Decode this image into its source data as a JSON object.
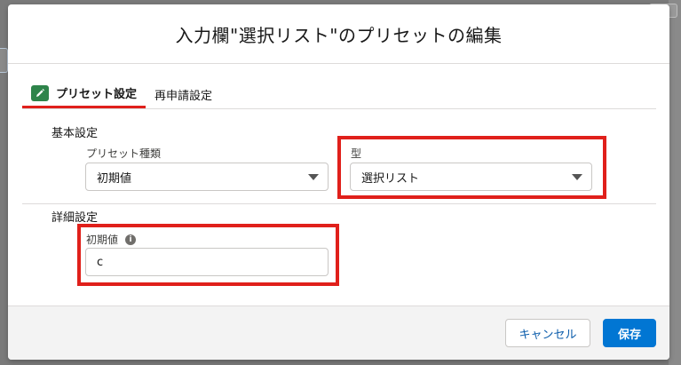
{
  "modal": {
    "title": "入力欄\"選択リスト\"のプリセットの編集"
  },
  "tabs": [
    {
      "label": "プリセット設定",
      "icon": "pencil-icon",
      "active": true
    },
    {
      "label": "再申請設定",
      "active": false
    }
  ],
  "basic": {
    "section_label": "基本設定",
    "preset_type": {
      "label": "プリセット種類",
      "value": "初期値"
    },
    "type": {
      "label": "型",
      "value": "選択リスト"
    }
  },
  "detail": {
    "section_label": "詳細設定",
    "initial_value": {
      "label": "初期値",
      "value": "c",
      "info_icon": "info-icon"
    }
  },
  "footer": {
    "cancel_label": "キャンセル",
    "save_label": "保存"
  },
  "colors": {
    "highlight": "#e0201b",
    "brand": "#0176d3",
    "tab_icon_bg": "#2e844a"
  }
}
